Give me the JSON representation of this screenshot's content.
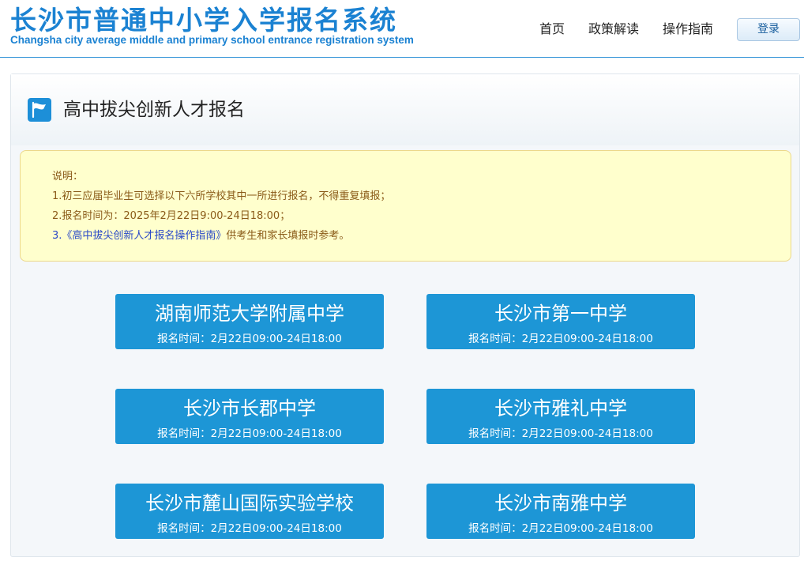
{
  "header": {
    "title": "长沙市普通中小学入学报名系统",
    "subtitle": "Changsha city average middle and primary school entrance registration system",
    "nav": [
      "首页",
      "政策解读",
      "操作指南"
    ],
    "login_label": "登录"
  },
  "panel": {
    "icon": "flag-icon",
    "title": "高中拔尖创新人才报名"
  },
  "notice": {
    "heading": "说明：",
    "line1": "1.初三应届毕业生可选择以下六所学校其中一所进行报名，不得重复填报；",
    "line2": "2.报名时间为：2025年2月22日9:00-24日18:00；",
    "line3_prefix": "3.",
    "line3_link": "《高中拔尖创新人才报名操作指南》",
    "line3_suffix": "供考生和家长填报时参考。"
  },
  "schools": [
    {
      "name": "湖南师范大学附属中学",
      "time": "报名时间：2月22日09:00-24日18:00"
    },
    {
      "name": "长沙市第一中学",
      "time": "报名时间：2月22日09:00-24日18:00"
    },
    {
      "name": "长沙市长郡中学",
      "time": "报名时间：2月22日09:00-24日18:00"
    },
    {
      "name": "长沙市雅礼中学",
      "time": "报名时间：2月22日09:00-24日18:00"
    },
    {
      "name": "长沙市麓山国际实验学校",
      "time": "报名时间：2月22日09:00-24日18:00"
    },
    {
      "name": "长沙市南雅中学",
      "time": "报名时间：2月22日09:00-24日18:00"
    }
  ],
  "colors": {
    "brand": "#1b82d2",
    "button": "#1d96d6",
    "notice_bg": "#ffffcd",
    "notice_text": "#8a5a18",
    "link": "#2a49c8"
  }
}
